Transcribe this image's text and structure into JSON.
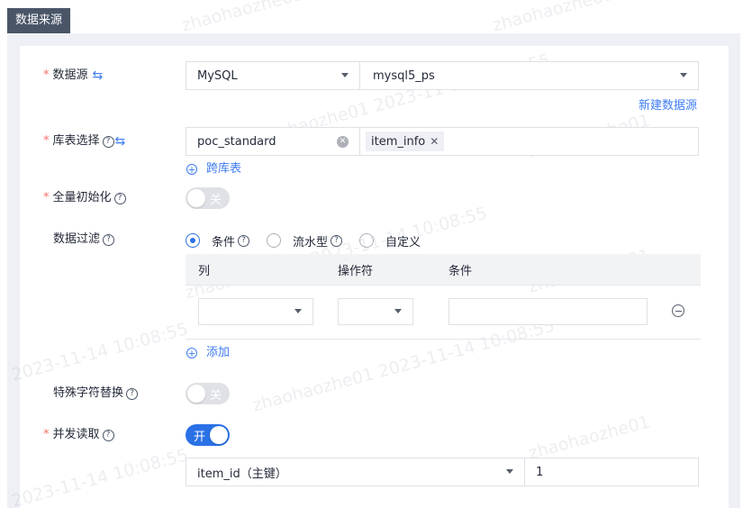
{
  "section_title": "数据来源",
  "form": {
    "datasource": {
      "label": "数据源",
      "type_value": "MySQL",
      "instance_value": "mysql5_ps",
      "new_link": "新建数据源"
    },
    "table_select": {
      "label": "库表选择",
      "db_value": "poc_standard",
      "table_tag": "item_info",
      "cross_link": "跨库表"
    },
    "full_init": {
      "label": "全量初始化",
      "switch_text": "关",
      "enabled": false
    },
    "data_filter": {
      "label": "数据过滤",
      "options": [
        "条件",
        "流水型",
        "自定义"
      ],
      "selected": "条件",
      "columns": [
        "列",
        "操作符",
        "条件"
      ],
      "add_link": "添加"
    },
    "special_char": {
      "label": "特殊字符替换",
      "switch_text": "关",
      "enabled": false
    },
    "concurrent_read": {
      "label": "并发读取",
      "switch_text": "开",
      "enabled": true,
      "key_value": "item_id（主键）",
      "count_value": "1"
    }
  },
  "watermark": {
    "name": "zhaohaozhe01",
    "datetime": "2023-11-14 10:08:55"
  },
  "colors": {
    "accent": "#2a71e6",
    "link": "#3e7cf4",
    "required": "#f66f6a",
    "section_tag": "#4a5568"
  }
}
